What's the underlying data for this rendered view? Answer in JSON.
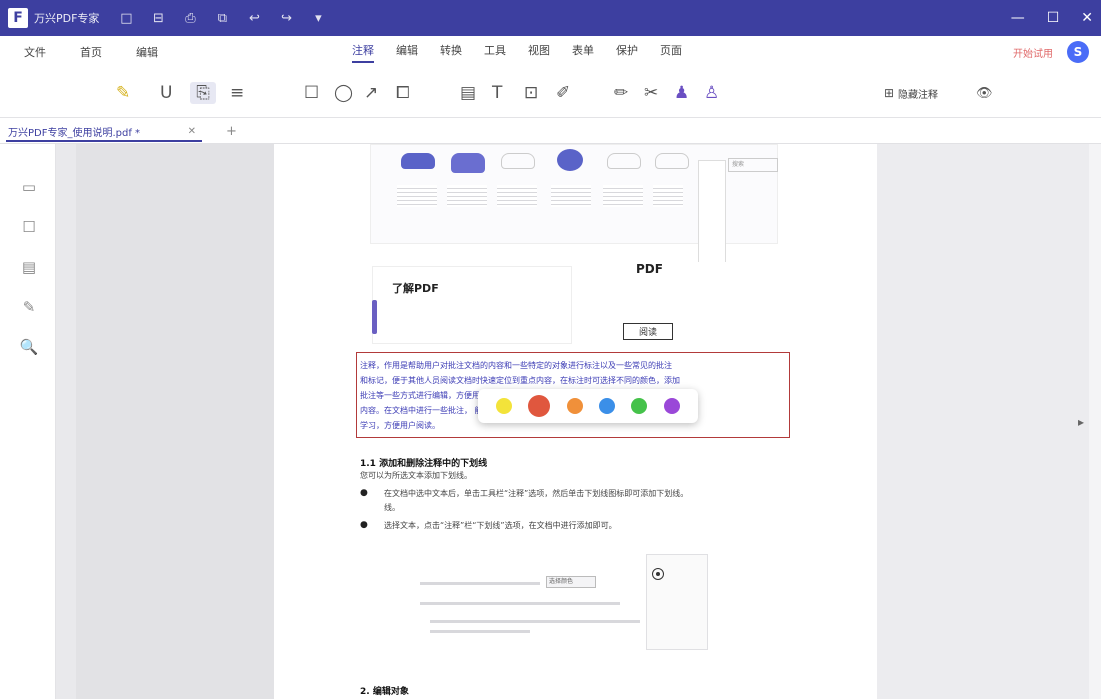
{
  "titlebar": {
    "app_name": "万兴PDF专家",
    "quick": [
      "□",
      "⊟",
      "⎙",
      "⧉",
      "↩",
      "↪",
      "▾"
    ],
    "controls": [
      "—",
      "☐",
      "✕"
    ]
  },
  "menu": {
    "left": [
      "文件",
      "首页",
      "编辑"
    ],
    "center": [
      "注释",
      "编辑",
      "转换",
      "工具",
      "视图",
      "表单",
      "保护",
      "页面"
    ],
    "active": "注释",
    "trial": "开始试用",
    "avatar": "S"
  },
  "toolbar": {
    "highlight": "✎",
    "underline": "U",
    "markup": "⎘",
    "strikeline": "≡",
    "rect": "☐",
    "circle": "◯",
    "arrow": "↗",
    "area": "⧠",
    "sticky": "▤",
    "text": "T",
    "textbox": "⊡",
    "pen": "✐",
    "pencil": "✏",
    "eraser": "✂",
    "stamp": "♟",
    "sign": "♙",
    "attach": "⊞",
    "attach_label": "隐藏注释",
    "eye": "👁"
  },
  "tab": {
    "label": "万兴PDF专家_使用说明.pdf *",
    "close": "✕",
    "add": "+"
  },
  "sidebar": [
    "▭",
    "☐",
    "▤",
    "✎",
    "🔍"
  ],
  "page": {
    "fig2_title": "了解PDF",
    "fig2_btn": "阅读",
    "fig2_logo": "PDF",
    "search_text": "搜索",
    "para_lines": [
      "注释，作用是帮助用户对批注文档的内容和一些特定的对象进行标注以及一些常见的批注",
      "和标记，便于其他人员阅读文档时快速定位到重点内容，在标注时可选择不同的颜色，添加",
      "批注等一些方式进行编辑，方便用户进行                                      便于审阅和修改文档",
      "内容。在文档中进行一些批注，                                              能更高效地工作与",
      "学习，方便用户阅读。"
    ],
    "swatches": [
      {
        "color": "#f3e33a",
        "selected": false
      },
      {
        "color": "#e0573e",
        "selected": true
      },
      {
        "color": "#f0903a",
        "selected": false
      },
      {
        "color": "#3b8fe8",
        "selected": false
      },
      {
        "color": "#45c24a",
        "selected": false
      },
      {
        "color": "#9a48d8",
        "selected": false
      }
    ],
    "heading1": "1.1 添加和删除注释中的下划线",
    "body1": "您可以为所选文本添加下划线。",
    "bullet1": "在文档中选中文本后，单击工具栏“注释”选项，然后单击下划线图标即可添加下划线。",
    "bullet1b": "线。",
    "bullet2": "选择文本，点击“注释”栏“下划线”选项，在文档中进行添加即可。",
    "fig3_box": "选择颜色",
    "heading2": "2. 编辑对象"
  }
}
